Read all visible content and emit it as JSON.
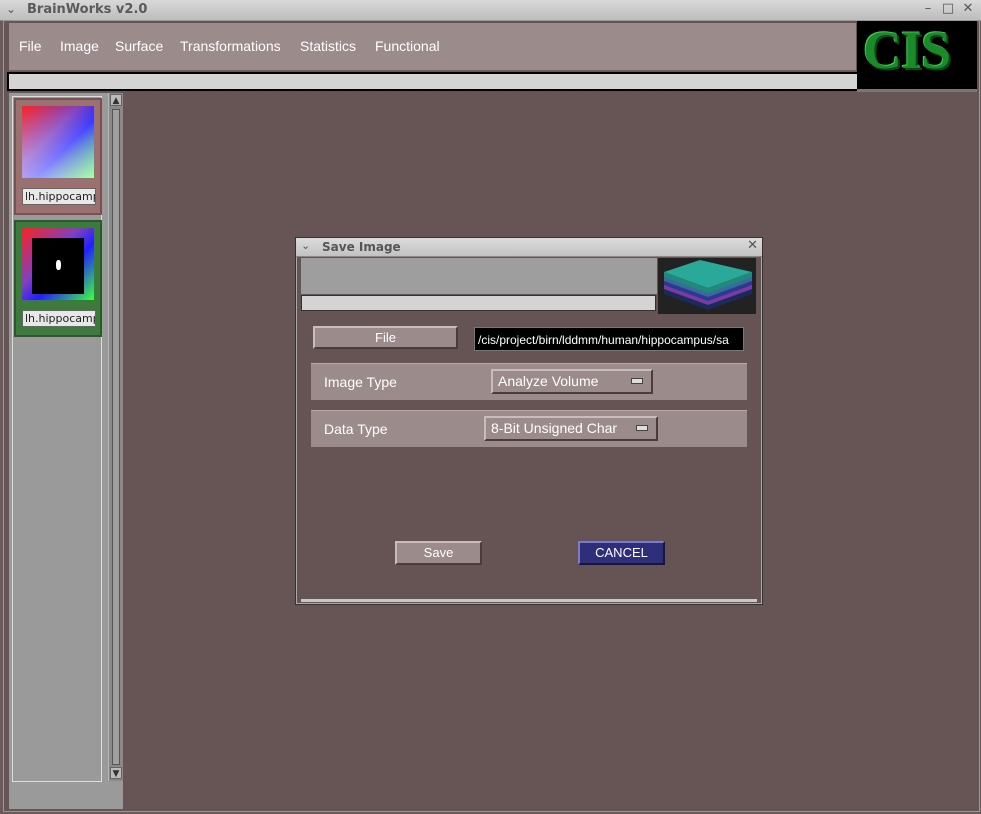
{
  "app": {
    "title": "BrainWorks v2.0"
  },
  "menu": [
    "File",
    "Image",
    "Surface",
    "Transformations",
    "Statistics",
    "Functional"
  ],
  "logo_text": "CIS",
  "thumbnails": [
    {
      "label": "lh.hippocampus"
    },
    {
      "label": "lh.hippocampus"
    }
  ],
  "dialog": {
    "title": "Save Image",
    "file_button": "File",
    "file_path": "/cis/project/birn/lddmm/human/hippocampus/sa",
    "image_type_label": "Image Type",
    "image_type_value": "Analyze Volume",
    "data_type_label": "Data Type",
    "data_type_value": "8-Bit  Unsigned Char",
    "save_label": "Save",
    "cancel_label": "CANCEL"
  },
  "colors": {
    "cancel_button": "#2e2e7a",
    "logo": "#1a8a2a"
  }
}
